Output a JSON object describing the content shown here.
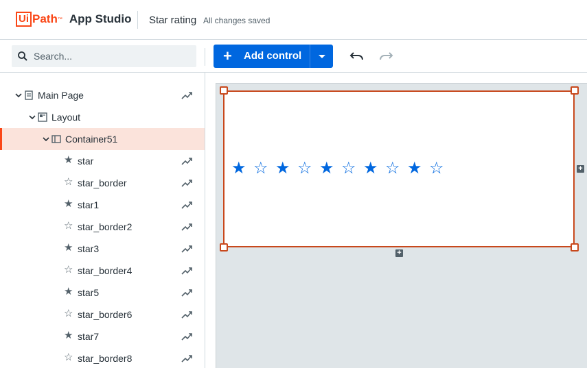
{
  "app": {
    "logo_box": "Ui",
    "logo_path": "Path",
    "logo_tm": "™",
    "product_name": "App Studio",
    "project_title": "Star rating",
    "save_status": "All changes saved"
  },
  "toolbar": {
    "search_placeholder": "Search...",
    "add_control_label": "Add control",
    "add_icon": "plus-icon",
    "undo_icon": "undo-icon",
    "redo_icon": "redo-icon"
  },
  "tree": {
    "main_page": "Main Page",
    "layout": "Layout",
    "container": "Container51",
    "items": [
      {
        "label": "star",
        "filled": true
      },
      {
        "label": "star_border",
        "filled": false
      },
      {
        "label": "star1",
        "filled": true
      },
      {
        "label": "star_border2",
        "filled": false
      },
      {
        "label": "star3",
        "filled": true
      },
      {
        "label": "star_border4",
        "filled": false
      },
      {
        "label": "star5",
        "filled": true
      },
      {
        "label": "star_border6",
        "filled": false
      },
      {
        "label": "star7",
        "filled": true
      },
      {
        "label": "star_border8",
        "filled": false
      }
    ]
  },
  "canvas": {
    "stars": [
      "★",
      "☆",
      "★",
      "☆",
      "★",
      "☆",
      "★",
      "☆",
      "★",
      "☆"
    ],
    "add_glyph": "+"
  },
  "colors": {
    "brand": "#fa4616",
    "primary": "#0067df",
    "selection": "#c8481c",
    "selected_row": "#fbe3db"
  }
}
